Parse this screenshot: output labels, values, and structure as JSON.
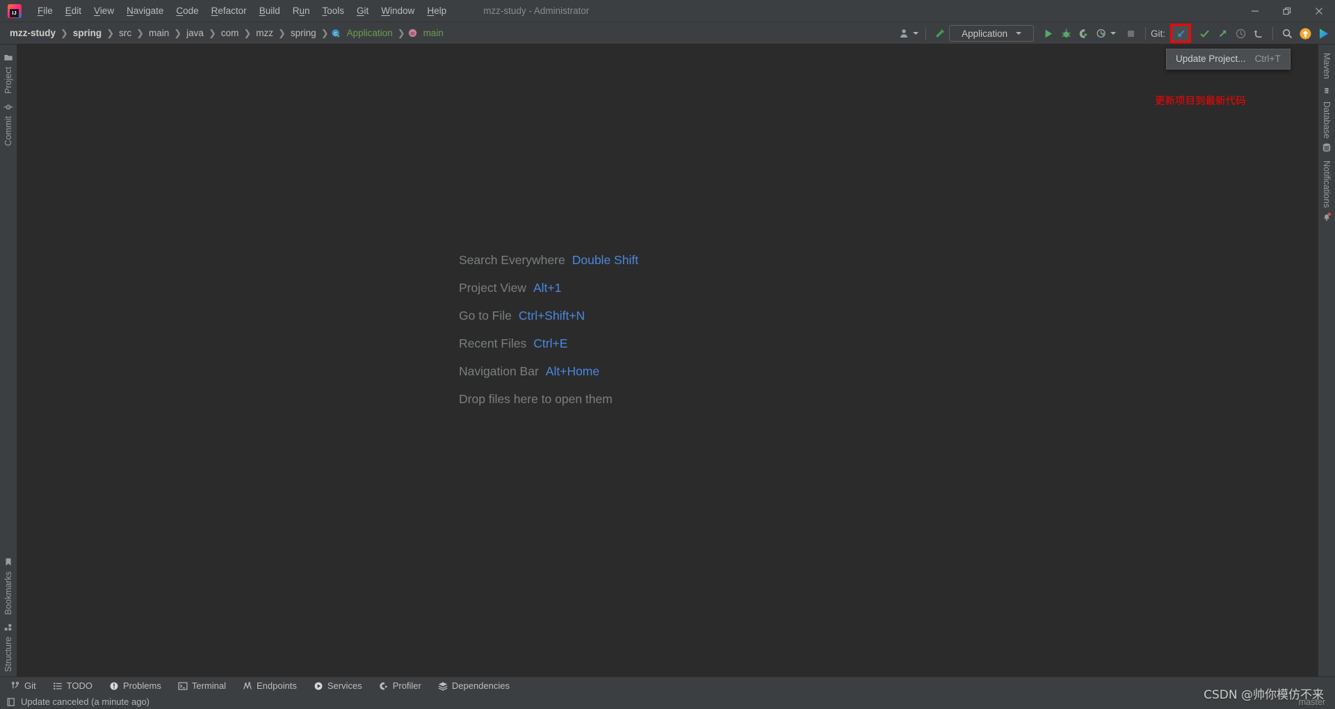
{
  "window": {
    "title": "mzz-study - Administrator",
    "logo_icon": "intellij-idea-logo",
    "controls": [
      {
        "name": "minimize-button",
        "icon": "minimize-icon"
      },
      {
        "name": "restore-button",
        "icon": "restore-icon"
      },
      {
        "name": "close-button",
        "icon": "close-icon"
      }
    ]
  },
  "menubar": {
    "items": [
      {
        "label": "File",
        "mnemonic": "F"
      },
      {
        "label": "Edit",
        "mnemonic": "E"
      },
      {
        "label": "View",
        "mnemonic": "V"
      },
      {
        "label": "Navigate",
        "mnemonic": "N"
      },
      {
        "label": "Code",
        "mnemonic": "C"
      },
      {
        "label": "Refactor",
        "mnemonic": "R"
      },
      {
        "label": "Build",
        "mnemonic": "B"
      },
      {
        "label": "Run",
        "mnemonic": "u"
      },
      {
        "label": "Tools",
        "mnemonic": "T"
      },
      {
        "label": "Git",
        "mnemonic": "G"
      },
      {
        "label": "Window",
        "mnemonic": "W"
      },
      {
        "label": "Help",
        "mnemonic": "H"
      }
    ]
  },
  "breadcrumbs": [
    {
      "label": "mzz-study",
      "style": "bold",
      "icon": ""
    },
    {
      "label": "spring",
      "style": "bold",
      "icon": ""
    },
    {
      "label": "src",
      "style": "plain",
      "icon": ""
    },
    {
      "label": "main",
      "style": "plain",
      "icon": ""
    },
    {
      "label": "java",
      "style": "plain",
      "icon": ""
    },
    {
      "label": "com",
      "style": "plain",
      "icon": ""
    },
    {
      "label": "mzz",
      "style": "plain",
      "icon": ""
    },
    {
      "label": "spring",
      "style": "plain",
      "icon": ""
    },
    {
      "label": "Application",
      "style": "green",
      "icon": "class-run-icon"
    },
    {
      "label": "main",
      "style": "green",
      "icon": "method-icon"
    }
  ],
  "toolbar": {
    "avatar_button": "avatar-icon",
    "build_button": "build-hammer-icon",
    "run_config": "Application",
    "run_button": "run-icon",
    "debug_button": "debug-icon",
    "run_coverage_button": "run-with-coverage-icon",
    "profiler_button": "profiler-icon",
    "stop_button": "stop-icon",
    "git_label": "Git:",
    "git_update_button": "update-project-icon",
    "git_commit_button": "commit-icon",
    "git_push_button": "push-icon",
    "git_history_button": "history-icon",
    "git_rollback_button": "rollback-icon",
    "search_button": "search-icon",
    "updates_button": "update-available-icon",
    "ide_button": "ide-services-icon"
  },
  "tooltip": {
    "label": "Update Project...",
    "shortcut": "Ctrl+T"
  },
  "annotation": {
    "text": "更新项目到最新代码",
    "color": "#ff0000"
  },
  "highlight": {
    "color": "#ff0000",
    "target": "git-update-project-button"
  },
  "left_stripe": {
    "top_items": [
      {
        "label": "Project",
        "icon": "project-folder-icon"
      },
      {
        "label": "Commit",
        "icon": "commit-node-icon"
      }
    ],
    "bottom_items": [
      {
        "label": "Bookmarks",
        "icon": "bookmark-icon"
      },
      {
        "label": "Structure",
        "icon": "structure-icon"
      }
    ]
  },
  "right_stripe": {
    "items": [
      {
        "label": "Maven",
        "icon": "maven-icon"
      },
      {
        "label": "Database",
        "icon": "database-icon"
      },
      {
        "label": "Notifications",
        "icon": "notifications-bell-icon"
      }
    ]
  },
  "editor_hints": [
    {
      "action": "Search Everywhere",
      "shortcut": "Double Shift"
    },
    {
      "action": "Project View",
      "shortcut": "Alt+1"
    },
    {
      "action": "Go to File",
      "shortcut": "Ctrl+Shift+N"
    },
    {
      "action": "Recent Files",
      "shortcut": "Ctrl+E"
    },
    {
      "action": "Navigation Bar",
      "shortcut": "Alt+Home"
    },
    {
      "action": "Drop files here to open them",
      "shortcut": ""
    }
  ],
  "tool_window_bar": [
    {
      "label": "Git",
      "icon": "git-branch-icon"
    },
    {
      "label": "TODO",
      "icon": "todo-list-icon"
    },
    {
      "label": "Problems",
      "icon": "problems-icon"
    },
    {
      "label": "Terminal",
      "icon": "terminal-icon"
    },
    {
      "label": "Endpoints",
      "icon": "endpoints-icon"
    },
    {
      "label": "Services",
      "icon": "services-icon"
    },
    {
      "label": "Profiler",
      "icon": "profiler-icon"
    },
    {
      "label": "Dependencies",
      "icon": "dependencies-icon"
    }
  ],
  "status_bar": {
    "icon": "event-log-icon",
    "message": "Update canceled (a minute ago)",
    "branch": "master"
  },
  "watermark": {
    "text": "CSDN @帅你模仿不来"
  },
  "colors": {
    "accent_blue": "#4a88df",
    "green": "#59a869",
    "red": "#ff0000",
    "bg_chrome": "#3c3f41",
    "bg_editor": "#2b2b2b"
  }
}
